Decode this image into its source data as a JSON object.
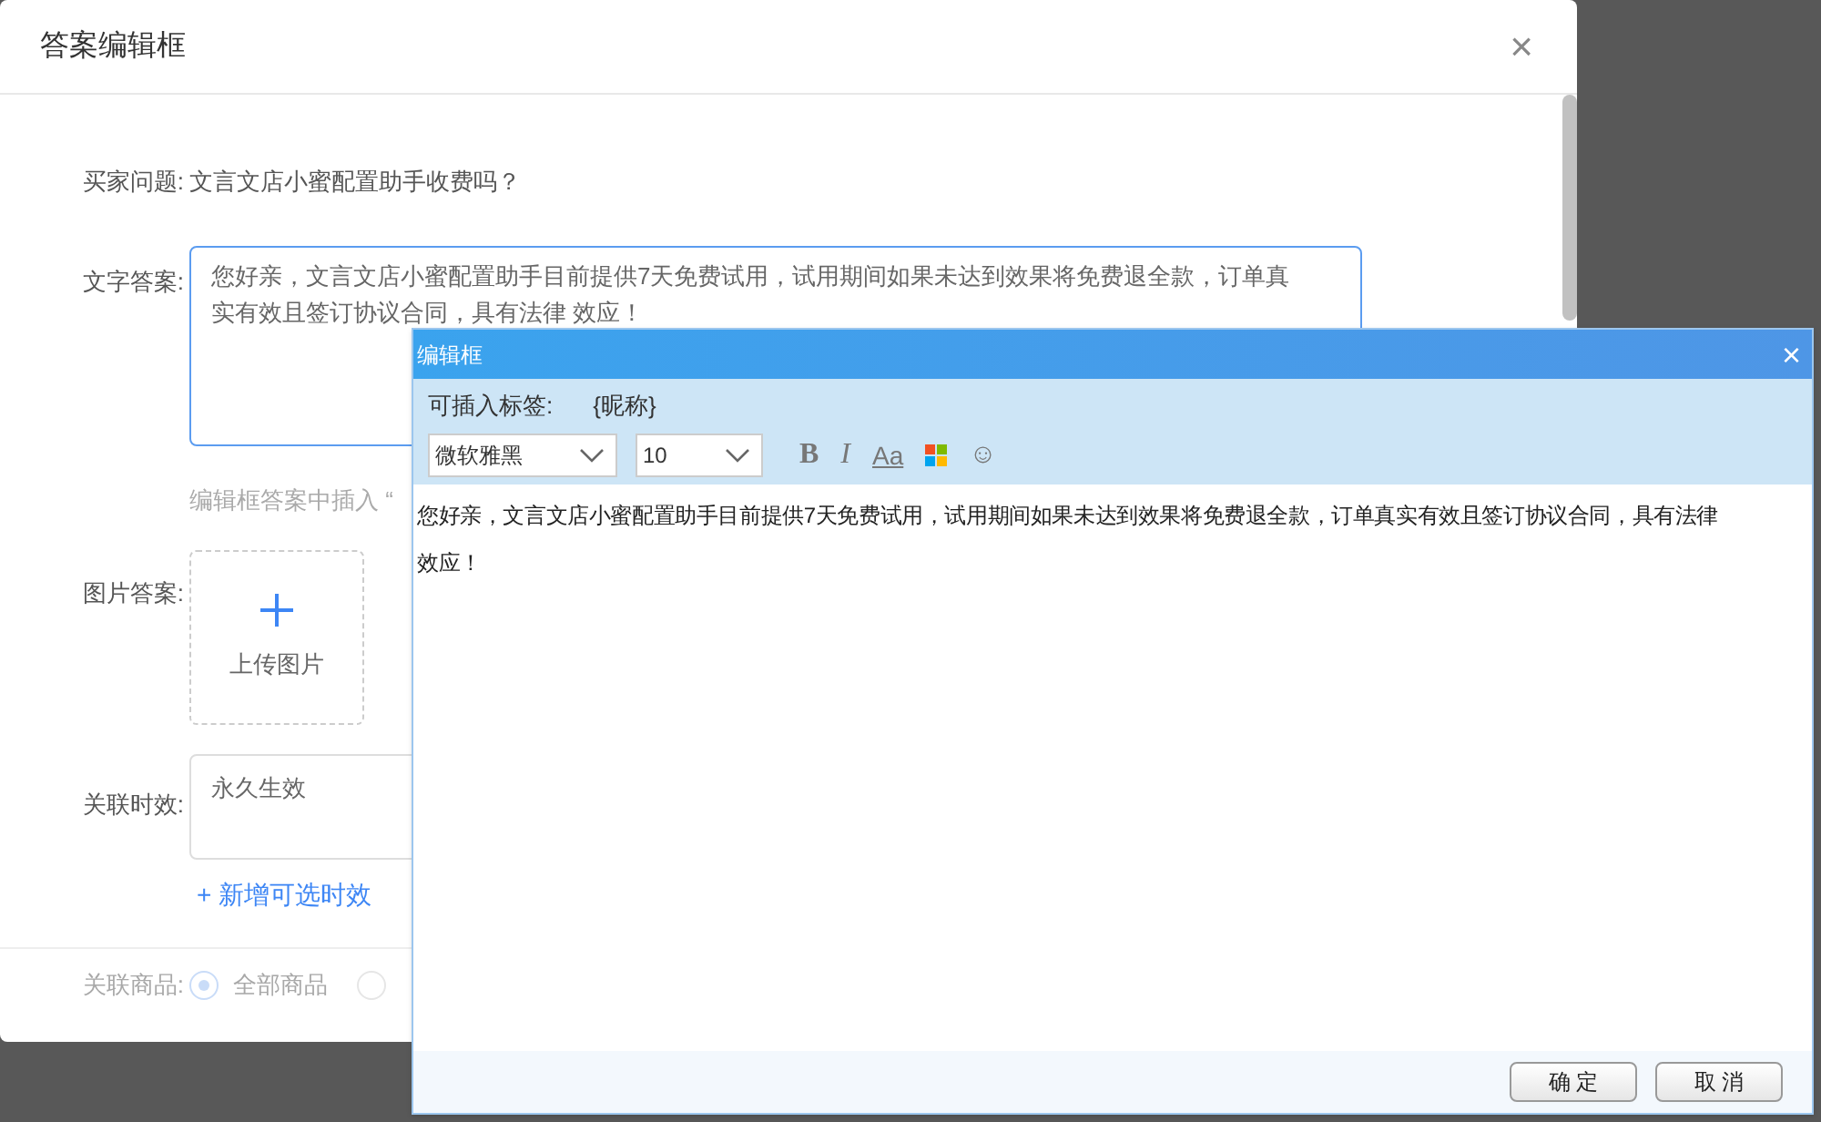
{
  "dialog": {
    "title": "答案编辑框",
    "close": "×",
    "question": {
      "label": "买家问题:",
      "value": "文言文店小蜜配置助手收费吗？"
    },
    "text_answer": {
      "label": "文字答案:",
      "lines": [
        "您好亲，文言文店小蜜配置助手目前提供7天免费试用，试用期间如果未达到效果将免费退全款，订单真",
        "实有效且签订协议合同，具有法律 效应！"
      ]
    },
    "hint": "编辑框答案中插入 “",
    "image_answer": {
      "label": "图片答案:",
      "upload": "上传图片"
    },
    "validity": {
      "label": "关联时效:",
      "value": "永久生效",
      "add_link": "+ 新增可选时效"
    },
    "goods": {
      "label": "关联商品:",
      "options": [
        {
          "label": "全部商品",
          "selected": true
        },
        {
          "selected": false
        }
      ]
    }
  },
  "editor": {
    "title": "编辑框",
    "close": "×",
    "tags_label": "可插入标签:",
    "tag": "{昵称}",
    "font": "微软雅黑",
    "size": "10",
    "tools": [
      {
        "kind": "bold",
        "text": "B"
      },
      {
        "kind": "italic",
        "text": "I"
      },
      {
        "kind": "case",
        "text": "Aa"
      },
      {
        "kind": "color"
      },
      {
        "kind": "emoji",
        "text": "☺"
      }
    ],
    "content_lines": [
      "您好亲，文言文店小蜜配置助手目前提供7天免费试用，试用期间如果未达到效果将免费退全款，订单真实有效且签订协议合同，具有法律",
      "效应！"
    ],
    "buttons": [
      "确 定",
      "取 消"
    ]
  }
}
